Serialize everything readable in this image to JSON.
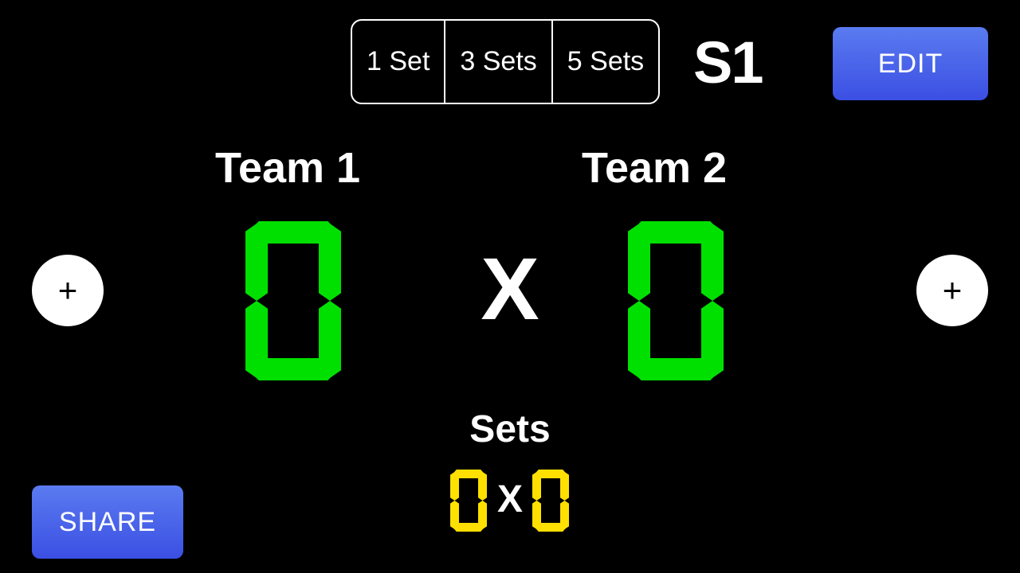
{
  "header": {
    "set_options": [
      "1 Set",
      "3 Sets",
      "5 Sets"
    ],
    "current_set_label": "S1",
    "edit_label": "EDIT"
  },
  "teams": {
    "team1": {
      "name": "Team 1",
      "score": "0"
    },
    "team2": {
      "name": "Team 2",
      "score": "0"
    }
  },
  "score_separator": "X",
  "sets": {
    "label": "Sets",
    "team1": "0",
    "separator": "X",
    "team2": "0"
  },
  "footer": {
    "share_label": "SHARE"
  },
  "controls": {
    "plus_glyph": "+"
  },
  "colors": {
    "score_digit": "#00e000",
    "set_digit": "#ffe000",
    "button_blue": "#3b4fe3"
  }
}
